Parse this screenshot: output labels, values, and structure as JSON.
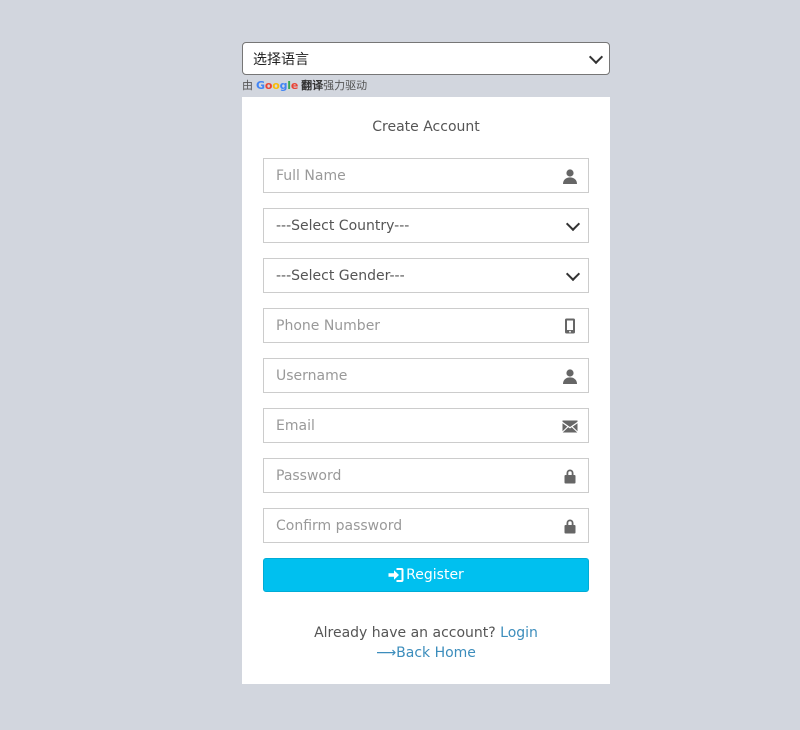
{
  "language": {
    "selected": "选择语言",
    "powered_prefix": "由",
    "google_logo": [
      "G",
      "o",
      "o",
      "g",
      "l",
      "e"
    ],
    "google_colors": [
      "#4285F4",
      "#EA4335",
      "#FBBC05",
      "#4285F4",
      "#34A853",
      "#EA4335"
    ],
    "translate_word": "翻译",
    "powered_suffix": "强力驱动"
  },
  "form": {
    "title": "Create Account",
    "full_name_placeholder": "Full Name",
    "country_selected": "---Select Country---",
    "gender_selected": "---Select Gender---",
    "phone_placeholder": "Phone Number",
    "username_placeholder": "Username",
    "email_placeholder": "Email",
    "password_placeholder": "Password",
    "confirm_password_placeholder": "Confirm password",
    "register_label": "Register"
  },
  "footer": {
    "have_account_text": "Already have an account?",
    "login_link": "Login",
    "back_home_link": "⟶Back Home"
  },
  "colors": {
    "background": "#d2d6de",
    "accent": "#00c0ef",
    "link": "#3c8dbc"
  },
  "icons": {
    "full_name": "user-icon",
    "phone": "mobile-phone-icon",
    "username": "user-icon",
    "email": "envelope-icon",
    "password": "lock-icon",
    "confirm_password": "lock-icon",
    "register": "sign-in-icon"
  }
}
